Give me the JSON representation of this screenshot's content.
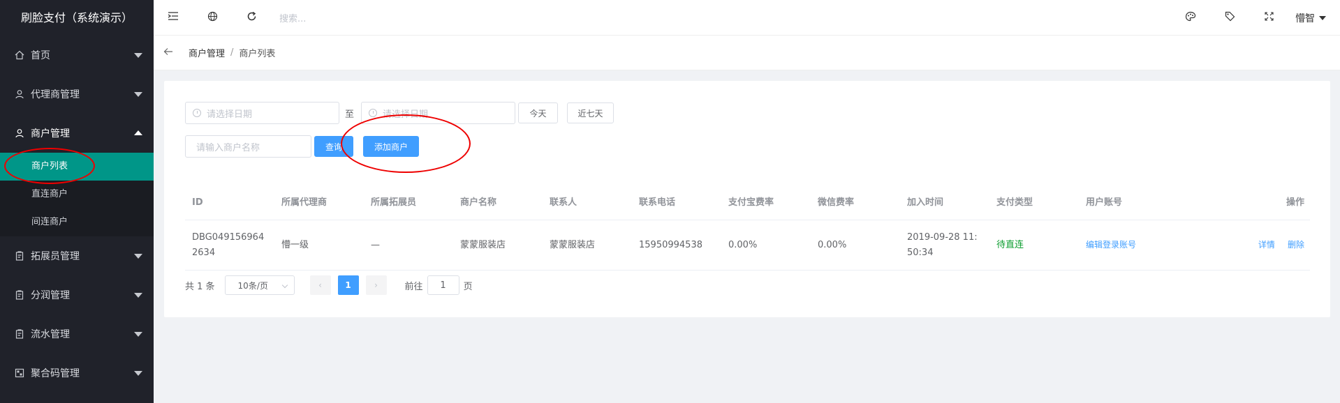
{
  "sidebar": {
    "brand": "刷脸支付（系统演示）",
    "items": [
      {
        "label": "首页",
        "icon": "home-icon"
      },
      {
        "label": "代理商管理",
        "icon": "user-icon"
      },
      {
        "label": "商户管理",
        "icon": "user-icon"
      },
      {
        "label": "拓展员管理",
        "icon": "clipboard-icon"
      },
      {
        "label": "分润管理",
        "icon": "clipboard-icon"
      },
      {
        "label": "流水管理",
        "icon": "clipboard-icon"
      },
      {
        "label": "聚合码管理",
        "icon": "qrcode-icon"
      }
    ],
    "submenu": [
      "商户列表",
      "直连商户",
      "间连商户"
    ]
  },
  "header": {
    "search_placeholder": "搜索...",
    "user": "懵智"
  },
  "breadcrumb": {
    "parent": "商户管理",
    "separator": "/",
    "current": "商户列表"
  },
  "filters": {
    "start_date_placeholder": "请选择日期",
    "to": "至",
    "end_date_placeholder": "请选择日期",
    "today": "今天",
    "last7": "近七天",
    "name_placeholder": "请输入商户名称",
    "query": "查询",
    "add": "添加商户"
  },
  "table": {
    "headers": [
      "ID",
      "所属代理商",
      "所属拓展员",
      "商户名称",
      "联系人",
      "联系电话",
      "支付宝费率",
      "微信费率",
      "加入时间",
      "支付类型",
      "用户账号",
      "操作"
    ],
    "rows": [
      {
        "id": "DBG0491569642634",
        "agent": "懵一级",
        "expander": "—",
        "name": "蒙蒙服装店",
        "contact": "蒙蒙服装店",
        "phone": "15950994538",
        "alipay_rate": "0.00%",
        "wechat_rate": "0.00%",
        "join_time": "2019-09-28 11:50:34",
        "pay_type": "待直连",
        "account": "编辑登录账号",
        "detail": "详情",
        "delete": "删除"
      }
    ]
  },
  "pager": {
    "total": "共 1 条",
    "page_size": "10条/页",
    "current": "1",
    "goto_label": "前往",
    "goto_value": "1",
    "page_suffix": "页"
  }
}
